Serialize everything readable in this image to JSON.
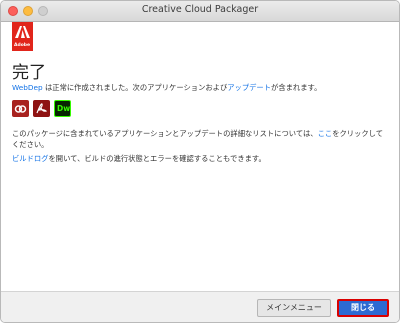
{
  "window": {
    "title": "Creative Cloud Packager"
  },
  "brand": {
    "logo_text": "Adobe"
  },
  "content": {
    "heading": "完了",
    "line1": {
      "package_name": "WebDep",
      "text_mid": " は正常に作成されました。次のアプリケーションおよび",
      "updates_link": "アップデート",
      "text_end": "が含まれます。"
    },
    "apps": [
      {
        "name": "creative-cloud-app-icon"
      },
      {
        "name": "acrobat-app-icon"
      },
      {
        "name": "dreamweaver-app-icon",
        "label": "Dw"
      }
    ],
    "para1": {
      "text_before": "このパッケージに含まれているアプリケーションとアップデートの詳細なリストについては、",
      "here_link": "ここ",
      "text_after": "をクリックしてください。"
    },
    "para2": {
      "build_log_link": "ビルドログ",
      "text_after": "を開いて、ビルドの進行状態とエラーを確認することもできます。"
    }
  },
  "footer": {
    "main_menu_label": "メインメニュー",
    "close_label": "閉じる"
  },
  "colors": {
    "accent": "#1473e6",
    "brand": "#e1251b",
    "close_highlight": "#d90000"
  }
}
